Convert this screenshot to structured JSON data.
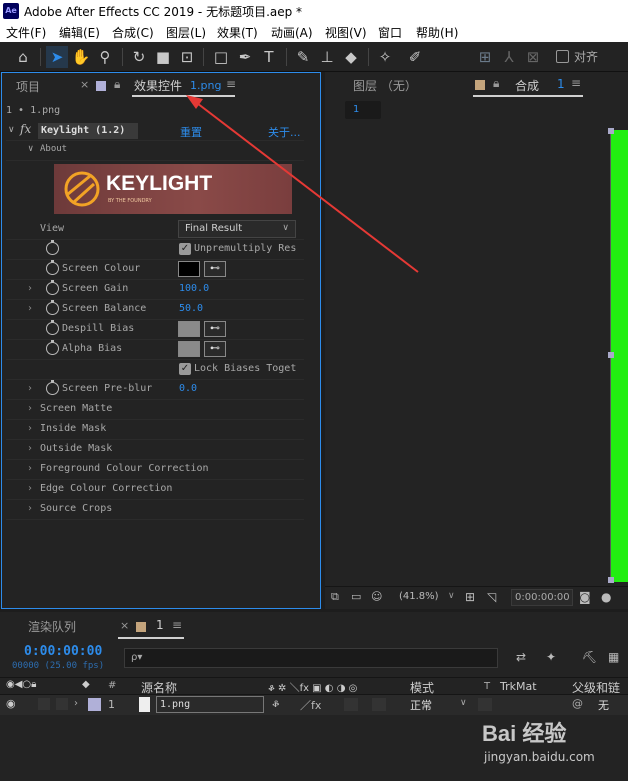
{
  "window": {
    "app_badge": "Ae",
    "title": "Adobe After Effects CC 2019 - 无标题项目.aep *"
  },
  "menu": [
    "文件(F)",
    "编辑(E)",
    "合成(C)",
    "图层(L)",
    "效果(T)",
    "动画(A)",
    "视图(V)",
    "窗口",
    "帮助(H)"
  ],
  "toolbar": {
    "snap_label": "对齐"
  },
  "left_panel": {
    "tab_project": "项目",
    "tab_effects": "效果控件",
    "tab_effects_file": "1.png",
    "breadcrumb": "1 • 1.png",
    "effect_name": "Keylight (1.2)",
    "reset_label": "重置",
    "about_label": "关于...",
    "about_group": "About",
    "logo_text": "KEYLIGHT",
    "logo_sub": "BY THE FOUNDRY",
    "view_label": "View",
    "view_value": "Final Result",
    "unpremultiply_label": "Unpremultiply Res",
    "screen_colour": "Screen Colour",
    "screen_gain": "Screen Gain",
    "screen_gain_value": "100.0",
    "screen_balance": "Screen Balance",
    "screen_balance_value": "50.0",
    "despill_bias": "Despill Bias",
    "alpha_bias": "Alpha Bias",
    "lock_biases_label": "Lock Biases Toget",
    "screen_preblur": "Screen Pre-blur",
    "screen_preblur_value": "0.0",
    "groups": [
      "Screen Matte",
      "Inside Mask",
      "Outside Mask",
      "Foreground Colour Correction",
      "Edge Colour Correction",
      "Source Crops"
    ]
  },
  "right_panel": {
    "tab_layer": "图层 （无）",
    "tab_comp": "合成",
    "tab_comp_num": "1",
    "comp_chip": "1",
    "zoom": "(41.8%)",
    "timecode": "0:00:00:00"
  },
  "bottom_panel": {
    "tab_render": "渲染队列",
    "tab_comp": "1",
    "timecode": "0:00:00:00",
    "frames": "00000 (25.00 fps)",
    "search_placeholder": "ρ▾",
    "col_hash": "#",
    "col_source": "源名称",
    "col_mode": "模式",
    "col_trkmat": "TrkMat",
    "col_parent": "父级和链",
    "layer_num": "1",
    "layer_name": "1.png",
    "layer_mode": "正常",
    "layer_parent": "无"
  },
  "colors": {
    "accent": "#2d8ceb",
    "comp_green": "#22ee11",
    "annotation_red": "#e53935"
  },
  "watermark": {
    "text": "Bai 经验",
    "sub": "jingyan.baidu.com"
  }
}
